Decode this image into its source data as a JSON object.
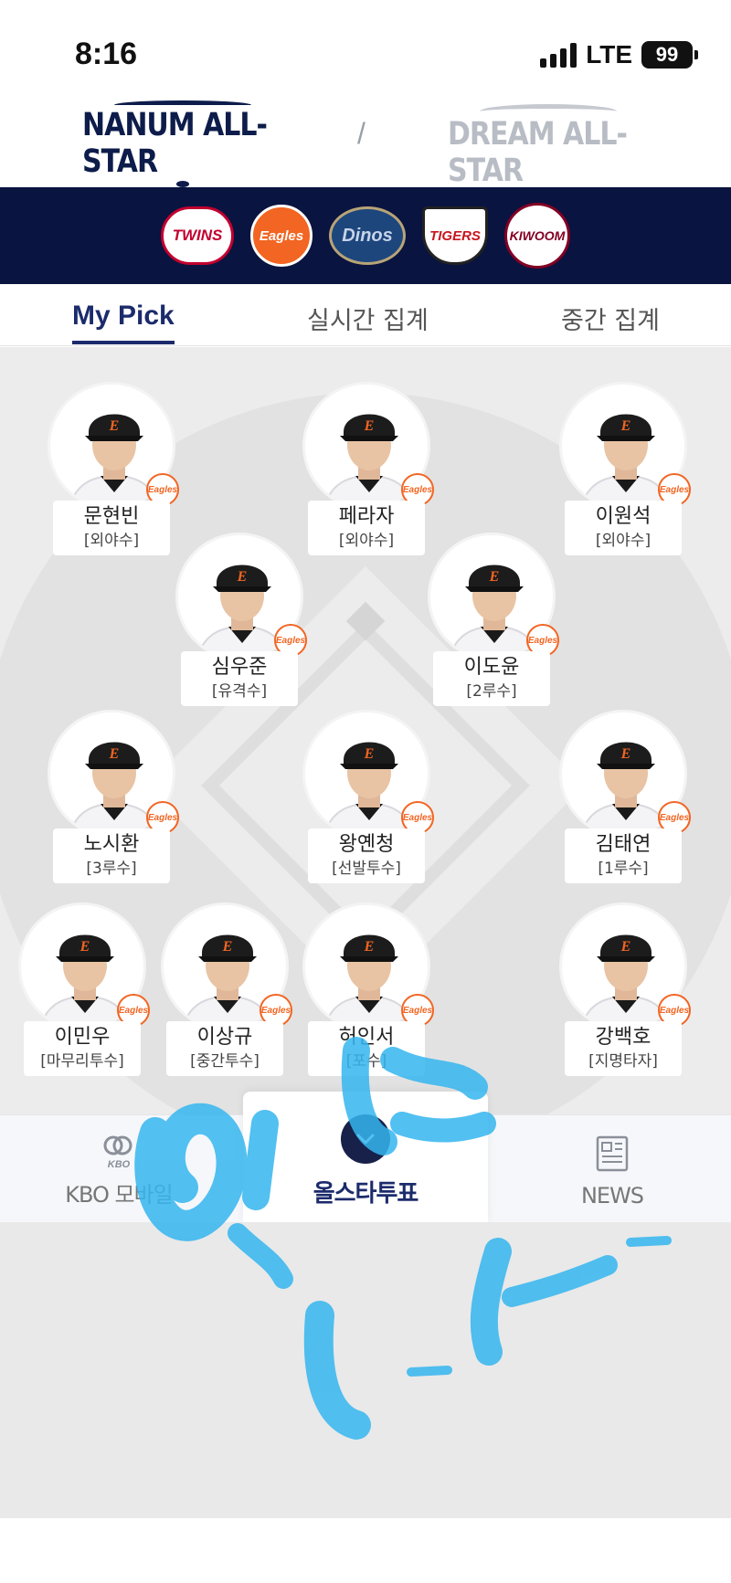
{
  "status": {
    "time": "8:16",
    "network": "LTE",
    "battery": "99"
  },
  "allstar": {
    "nanum": "NANUM ALL-STAR",
    "divider": "/",
    "dream": "DREAM ALL-STAR"
  },
  "teams": [
    {
      "name": "TWINS",
      "icon": "lg-twins-logo"
    },
    {
      "name": "Eagles",
      "icon": "hanwha-eagles-logo"
    },
    {
      "name": "Dinos",
      "icon": "nc-dinos-logo"
    },
    {
      "name": "TIGERS",
      "icon": "kia-tigers-logo"
    },
    {
      "name": "KIWOOM",
      "icon": "kiwoom-heroes-logo"
    }
  ],
  "tabs": {
    "mypick": "My Pick",
    "live": "실시간 집계",
    "mid": "중간 집계"
  },
  "team_badge": "Eagles",
  "players": [
    {
      "name": "문현빈",
      "pos": "[외야수]"
    },
    {
      "name": "페라자",
      "pos": "[외야수]"
    },
    {
      "name": "이원석",
      "pos": "[외야수]"
    },
    {
      "name": "심우준",
      "pos": "[유격수]"
    },
    {
      "name": "이도윤",
      "pos": "[2루수]"
    },
    {
      "name": "노시환",
      "pos": "[3루수]"
    },
    {
      "name": "왕옌청",
      "pos": "[선발투수]"
    },
    {
      "name": "김태연",
      "pos": "[1루수]"
    },
    {
      "name": "이민우",
      "pos": "[마무리투수]"
    },
    {
      "name": "이상규",
      "pos": "[중간투수]"
    },
    {
      "name": "허인서",
      "pos": "[포수]"
    },
    {
      "name": "강백호",
      "pos": "[지명타자]"
    }
  ],
  "nav": {
    "kbo_icon_text": "KBO",
    "kbo": "KBO 모바일",
    "vote": "올스타투표",
    "news": "NEWS"
  },
  "colors": {
    "navy": "#0a1440",
    "accent": "#1c2b6b",
    "eagles_orange": "#f26522",
    "scribble": "#35b6ef"
  }
}
